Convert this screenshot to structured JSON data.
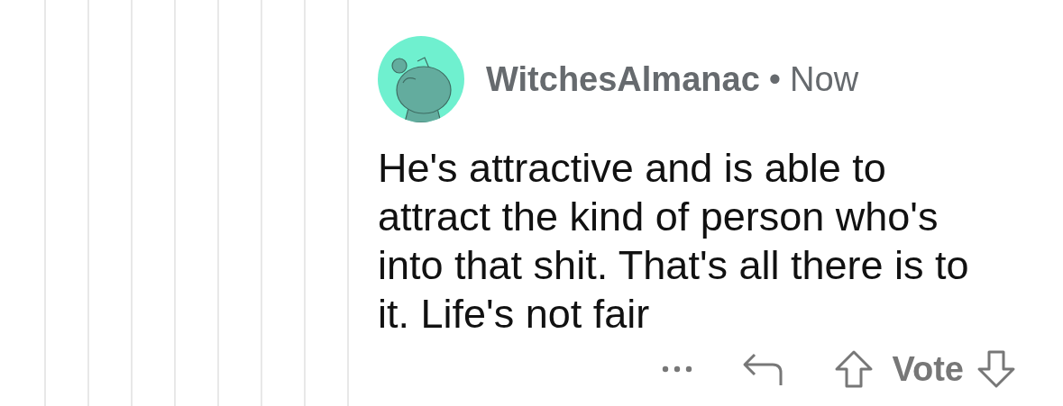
{
  "comment": {
    "author": "WitchesAlmanac",
    "separator": "•",
    "time": "Now",
    "body": [
      "He's attractive and is able to",
      "attract the kind of person who's",
      "into that shit. That's all there is to",
      "it. Life's not fair"
    ]
  },
  "actions": {
    "vote_label": "Vote"
  }
}
